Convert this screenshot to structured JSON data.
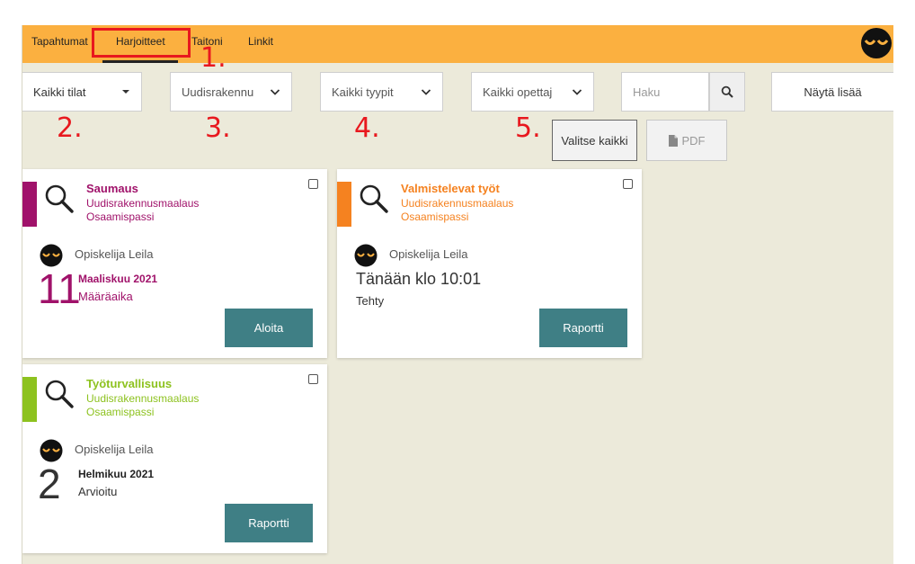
{
  "nav": {
    "items": [
      "Tapahtumat",
      "Harjoitteet",
      "Taitoni",
      "Linkit"
    ],
    "active_index": 1
  },
  "annotations": [
    "1.",
    "2.",
    "3.",
    "4.",
    "5."
  ],
  "filters": {
    "status": "Kaikki tilat",
    "program": "Uudisrakennu",
    "type": "Kaikki tyypit",
    "teacher": "Kaikki opettaj",
    "search_placeholder": "Haku",
    "show_more": "Näytä lisää",
    "select_all": "Valitse kaikki",
    "pdf": "PDF"
  },
  "cards": [
    {
      "title": "Saumaus",
      "program": "Uudisrakennusmaalaus",
      "passport": "Osaamispassi",
      "student": "Opiskelija Leila",
      "day": "11",
      "month": "Maaliskuu 2021",
      "status": "Määräaika",
      "action": "Aloita",
      "color": "#a0126a"
    },
    {
      "title": "Valmistelevat työt",
      "program": "Uudisrakennusmaalaus",
      "passport": "Osaamispassi",
      "student": "Opiskelija Leila",
      "time": "Tänään klo 10:01",
      "status": "Tehty",
      "action": "Raportti",
      "color": "#f58220"
    },
    {
      "title": "Työturvallisuus",
      "program": "Uudisrakennusmaalaus",
      "passport": "Osaamispassi",
      "student": "Opiskelija Leila",
      "day": "2",
      "month": "Helmikuu 2021",
      "status": "Arvioitu",
      "action": "Raportti",
      "color": "#8dc21f"
    }
  ],
  "colors": {
    "navbar": "#fbb040",
    "background": "#eceada",
    "button": "#3f7f85",
    "annotation": "#e8181e"
  },
  "icons": {
    "search": "search-icon",
    "magnifier": "magnifier-icon",
    "avatar": "avatar-icon",
    "chevron": "chevron-down-icon",
    "caret": "caret-down-icon",
    "pdf": "document-icon",
    "checkbox": "checkbox-icon"
  }
}
